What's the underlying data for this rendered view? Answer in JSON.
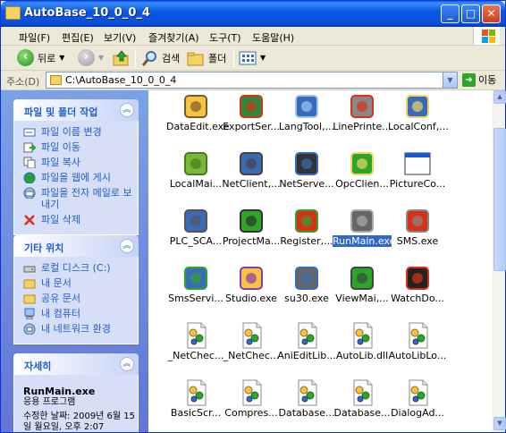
{
  "window": {
    "title": "AutoBase_10_0_0_4"
  },
  "menu": [
    "파일(F)",
    "편집(E)",
    "보기(V)",
    "즐겨찾기(A)",
    "도구(T)",
    "도움말(H)"
  ],
  "toolbar": {
    "back": "뒤로",
    "search": "검색",
    "folders": "폴더"
  },
  "address": {
    "label": "주소(D)",
    "value": "C:\\AutoBase_10_0_0_4",
    "go": "이동"
  },
  "tasks_panel": {
    "title": "파일 및 폴더 작업",
    "items": [
      "파일 이름 변경",
      "파일 이동",
      "파일 복사",
      "파일을 웹에 게시",
      "파일을 전자 메일로 보내기",
      "파일 삭제"
    ]
  },
  "places_panel": {
    "title": "기타 위치",
    "items": [
      "로컬 디스크 (C:)",
      "내 문서",
      "공유 문서",
      "내 컴퓨터",
      "내 네트워크 환경"
    ]
  },
  "details_panel": {
    "title": "자세히",
    "name": "RunMain.exe",
    "type": "응용 프로그램",
    "modified": "수정한 날짜: 2009년 6월 15일 월요일, 오후 2:07"
  },
  "files": [
    {
      "label": "DataEdit.exe",
      "icon": "dataedit-icon",
      "selected": false
    },
    {
      "label": "ExportSer...",
      "icon": "export-icon",
      "selected": false
    },
    {
      "label": "LangTool,...",
      "icon": "langtool-icon",
      "selected": false
    },
    {
      "label": "LinePrinte...",
      "icon": "printer-warning-icon",
      "selected": false
    },
    {
      "label": "LocalConf,...",
      "icon": "localconf-icon",
      "selected": false
    },
    {
      "label": "LocalMai...",
      "icon": "localmain-icon",
      "selected": false
    },
    {
      "label": "NetClient,...",
      "icon": "netclient-icon",
      "selected": false
    },
    {
      "label": "NetServe...",
      "icon": "netserver-icon",
      "selected": false
    },
    {
      "label": "OpcClien...",
      "icon": "opcclient-icon",
      "selected": false
    },
    {
      "label": "PictureCo...",
      "icon": "picture-window-icon",
      "selected": false
    },
    {
      "label": "PLC_SCA...",
      "icon": "plc-scan-icon",
      "selected": false
    },
    {
      "label": "ProjectMa...",
      "icon": "project-manager-icon",
      "selected": false
    },
    {
      "label": "Register,...",
      "icon": "register-icon",
      "selected": false
    },
    {
      "label": "RunMain.exe",
      "icon": "runmain-icon",
      "selected": true
    },
    {
      "label": "SMS.exe",
      "icon": "sms-icon",
      "selected": false
    },
    {
      "label": "SmsServi...",
      "icon": "sms-service-icon",
      "selected": false
    },
    {
      "label": "Studio.exe",
      "icon": "studio-icon",
      "selected": false
    },
    {
      "label": "su30.exe",
      "icon": "su30-icon",
      "selected": false
    },
    {
      "label": "ViewMai,...",
      "icon": "viewmain-icon",
      "selected": false
    },
    {
      "label": "WatchDo...",
      "icon": "watchdog-icon",
      "selected": false
    },
    {
      "label": "_NetChec...",
      "icon": "dll-gear-icon",
      "selected": false
    },
    {
      "label": "_NetChec...",
      "icon": "dll-gear-icon",
      "selected": false
    },
    {
      "label": "AniEditLib...",
      "icon": "dll-gear-icon",
      "selected": false
    },
    {
      "label": "AutoLib.dll",
      "icon": "dll-gear-icon",
      "selected": false
    },
    {
      "label": "AutoLibLo...",
      "icon": "dll-gear-icon",
      "selected": false
    },
    {
      "label": "BasicScr...",
      "icon": "dll-gear-icon",
      "selected": false
    },
    {
      "label": "Compres...",
      "icon": "dll-gear-icon",
      "selected": false
    },
    {
      "label": "Database...",
      "icon": "dll-gear-icon",
      "selected": false
    },
    {
      "label": "Database...",
      "icon": "dll-gear-icon",
      "selected": false
    },
    {
      "label": "DialogAd...",
      "icon": "dll-gear-icon",
      "selected": false
    }
  ]
}
